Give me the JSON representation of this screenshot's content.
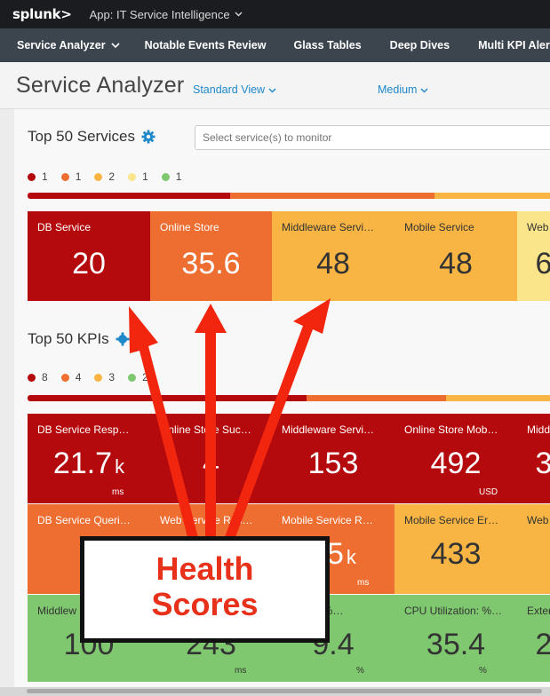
{
  "topbar": {
    "logo": "splunk>",
    "app_label": "App: IT Service Intelligence"
  },
  "nav": {
    "items": [
      "Service Analyzer",
      "Notable Events Review",
      "Glass Tables",
      "Deep Dives",
      "Multi KPI Alerts"
    ]
  },
  "header": {
    "title": "Service Analyzer",
    "view": "Standard View",
    "size": "Medium"
  },
  "services": {
    "title": "Top 50 Services",
    "search_placeholder": "Select service(s) to monitor",
    "counts": [
      {
        "value": "1",
        "color": "#b50a0d"
      },
      {
        "value": "1",
        "color": "#ee6d31"
      },
      {
        "value": "2",
        "color": "#f8b543"
      },
      {
        "value": "1",
        "color": "#fbe58a"
      },
      {
        "value": "1",
        "color": "#7fc86f"
      }
    ],
    "tiles": [
      {
        "name": "DB Service",
        "value": "20"
      },
      {
        "name": "Online Store",
        "value": "35.6"
      },
      {
        "name": "Middleware Servi…",
        "value": "48"
      },
      {
        "name": "Mobile Service",
        "value": "48"
      },
      {
        "name": "Web",
        "value": "6"
      }
    ]
  },
  "kpis": {
    "title": "Top 50 KPIs",
    "counts": [
      {
        "value": "8",
        "color": "#b50a0d"
      },
      {
        "value": "4",
        "color": "#ee6d31"
      },
      {
        "value": "3",
        "color": "#f8b543"
      },
      {
        "value": "20",
        "color": "#7fc86f"
      }
    ],
    "rows": [
      [
        {
          "name": "DB Service Resp…",
          "value": "21.7",
          "unit_k": "k",
          "sub": "ms"
        },
        {
          "name": "Online Store Suc…",
          "value": "4"
        },
        {
          "name": "Middleware Servi…",
          "value": "153"
        },
        {
          "name": "Online Store Mob…",
          "value": "492",
          "sub": "USD"
        },
        {
          "name": "Midd",
          "value": "3"
        }
      ],
      [
        {
          "name": "DB Service Queri…",
          "value": "7"
        },
        {
          "name": "Web Service Res…",
          "value": ""
        },
        {
          "name": "Mobile Service R…",
          "value": "95",
          "unit_k": "k",
          "sub": "ms"
        },
        {
          "name": "Mobile Service Er…",
          "value": "433"
        },
        {
          "name": "Web",
          "value": ""
        }
      ],
      [
        {
          "name": "Middlew",
          "value": "100"
        },
        {
          "name": "",
          "value": "243",
          "sub": "ms"
        },
        {
          "name": "ilization: %…",
          "value": "9.4",
          "sub": "%"
        },
        {
          "name": "CPU Utilization: %…",
          "value": "35.4",
          "sub": "%"
        },
        {
          "name": "Exter",
          "value": "2"
        }
      ]
    ]
  },
  "callout": {
    "line1": "Health",
    "line2": "Scores"
  },
  "colors": {
    "critical": "#b50a0d",
    "high": "#ee6d31",
    "medium": "#f8b543",
    "low": "#fbe58a",
    "normal": "#7fc86f",
    "accent": "#1e88c9",
    "arrow": "#f2260f"
  },
  "icons": [
    "chevron-down-icon",
    "gear-icon"
  ]
}
